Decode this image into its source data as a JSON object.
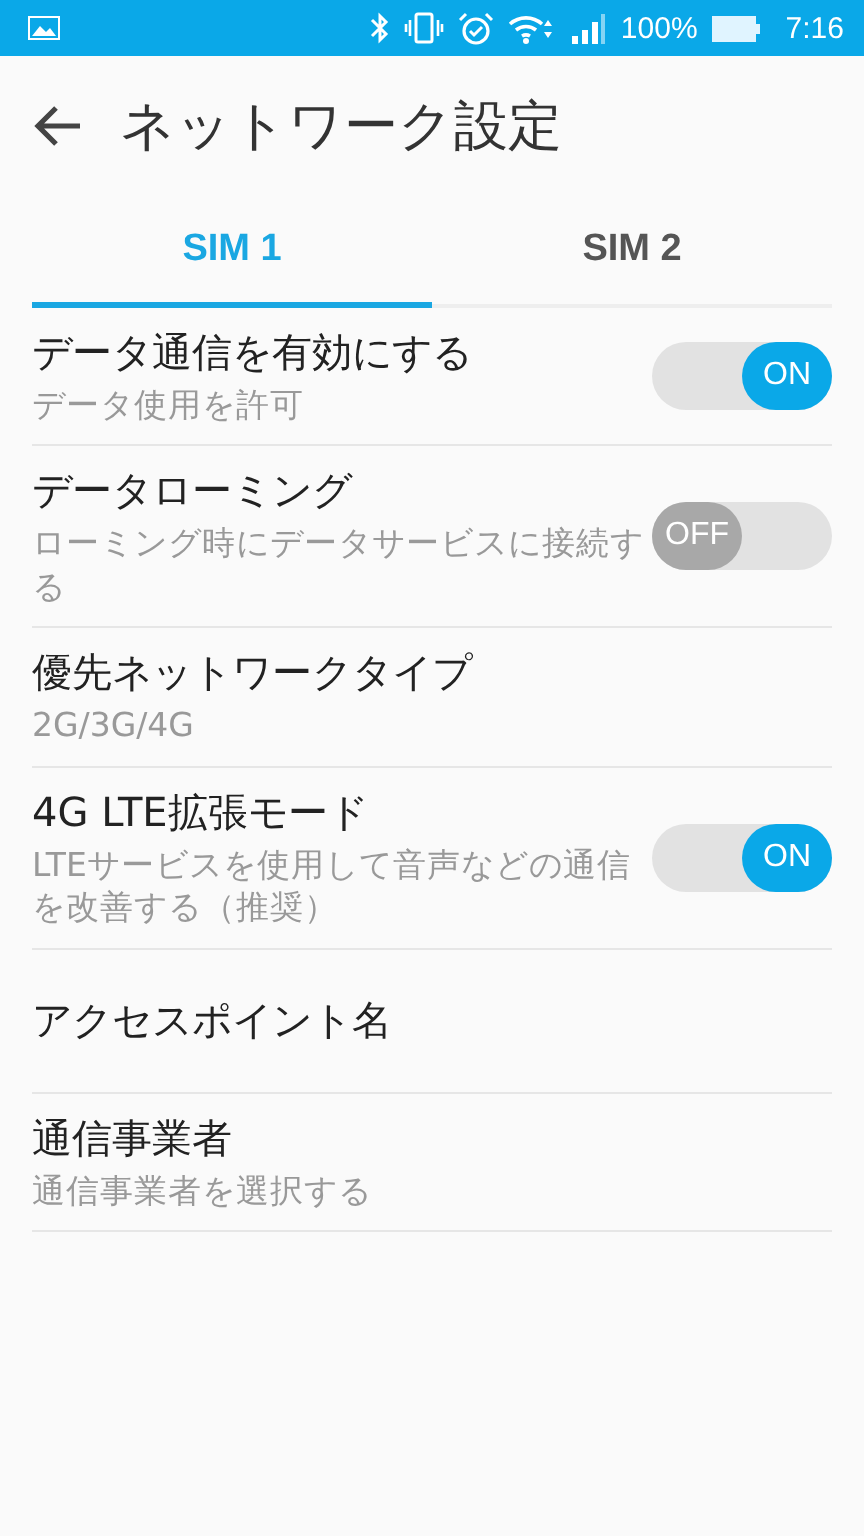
{
  "status_bar": {
    "battery": "100%",
    "time": "7:16"
  },
  "header": {
    "title": "ネットワーク設定"
  },
  "tabs": [
    {
      "label": "SIM 1",
      "selected": true
    },
    {
      "label": "SIM 2",
      "selected": false
    }
  ],
  "settings": [
    {
      "kind": "toggle",
      "title": "データ通信を有効にする",
      "subtitle": "データ使用を許可",
      "on": true,
      "toggle_label": "ON"
    },
    {
      "kind": "toggle",
      "title": "データローミング",
      "subtitle": "ローミング時にデータサービスに接続する",
      "on": false,
      "toggle_label": "OFF"
    },
    {
      "kind": "plain",
      "title": "優先ネットワークタイプ",
      "subtitle": "2G/3G/4G"
    },
    {
      "kind": "toggle",
      "title": "4G LTE拡張モード",
      "subtitle": "LTEサービスを使用して音声などの通信を改善する（推奨）",
      "on": true,
      "toggle_label": "ON"
    },
    {
      "kind": "plain",
      "title": "アクセスポイント名"
    },
    {
      "kind": "plain",
      "title": "通信事業者",
      "subtitle": "通信事業者を選択する"
    }
  ]
}
